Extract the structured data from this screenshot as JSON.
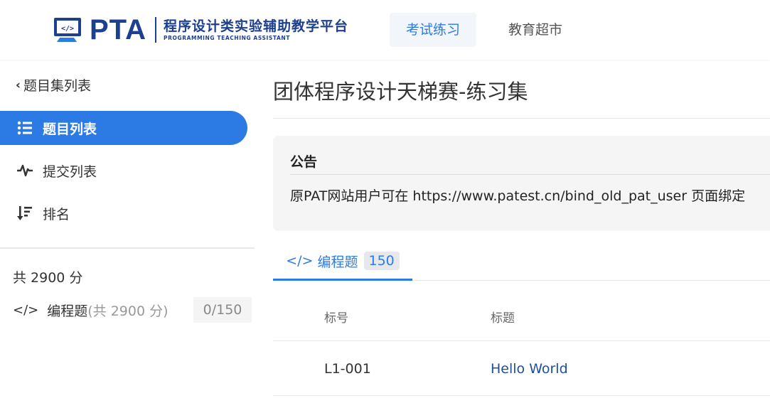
{
  "header": {
    "logo_text": "PTA",
    "logo_cn": "程序设计类实验辅助教学平台",
    "logo_en": "PROGRAMMING TEACHING ASSISTANT",
    "nav": [
      {
        "label": "考试练习",
        "active": true
      },
      {
        "label": "教育超市",
        "active": false
      }
    ]
  },
  "sidebar": {
    "back_label": "题目集列表",
    "items": [
      {
        "label": "题目列表",
        "icon": "list-icon",
        "active": true
      },
      {
        "label": "提交列表",
        "icon": "pulse-icon",
        "active": false
      },
      {
        "label": "排名",
        "icon": "sort-icon",
        "active": false
      }
    ],
    "total": "共 2900 分",
    "programming": {
      "label": "编程题",
      "sub": "(共 2900 分)",
      "count": "0/150"
    }
  },
  "main": {
    "title": "团体程序设计天梯赛-练习集",
    "notice": {
      "title": "公告",
      "body": "原PAT网站用户可在 https://www.patest.cn/bind_old_pat_user 页面绑定"
    },
    "tabs": [
      {
        "label": "编程题",
        "badge": "150",
        "active": true
      }
    ],
    "table": {
      "headers": [
        "标号",
        "标题"
      ],
      "rows": [
        {
          "num": "L1-001",
          "title": "Hello World"
        }
      ]
    }
  },
  "colors": {
    "accent": "#2c7be5",
    "brand": "#1d3f8f",
    "link": "#1d4e9a"
  }
}
